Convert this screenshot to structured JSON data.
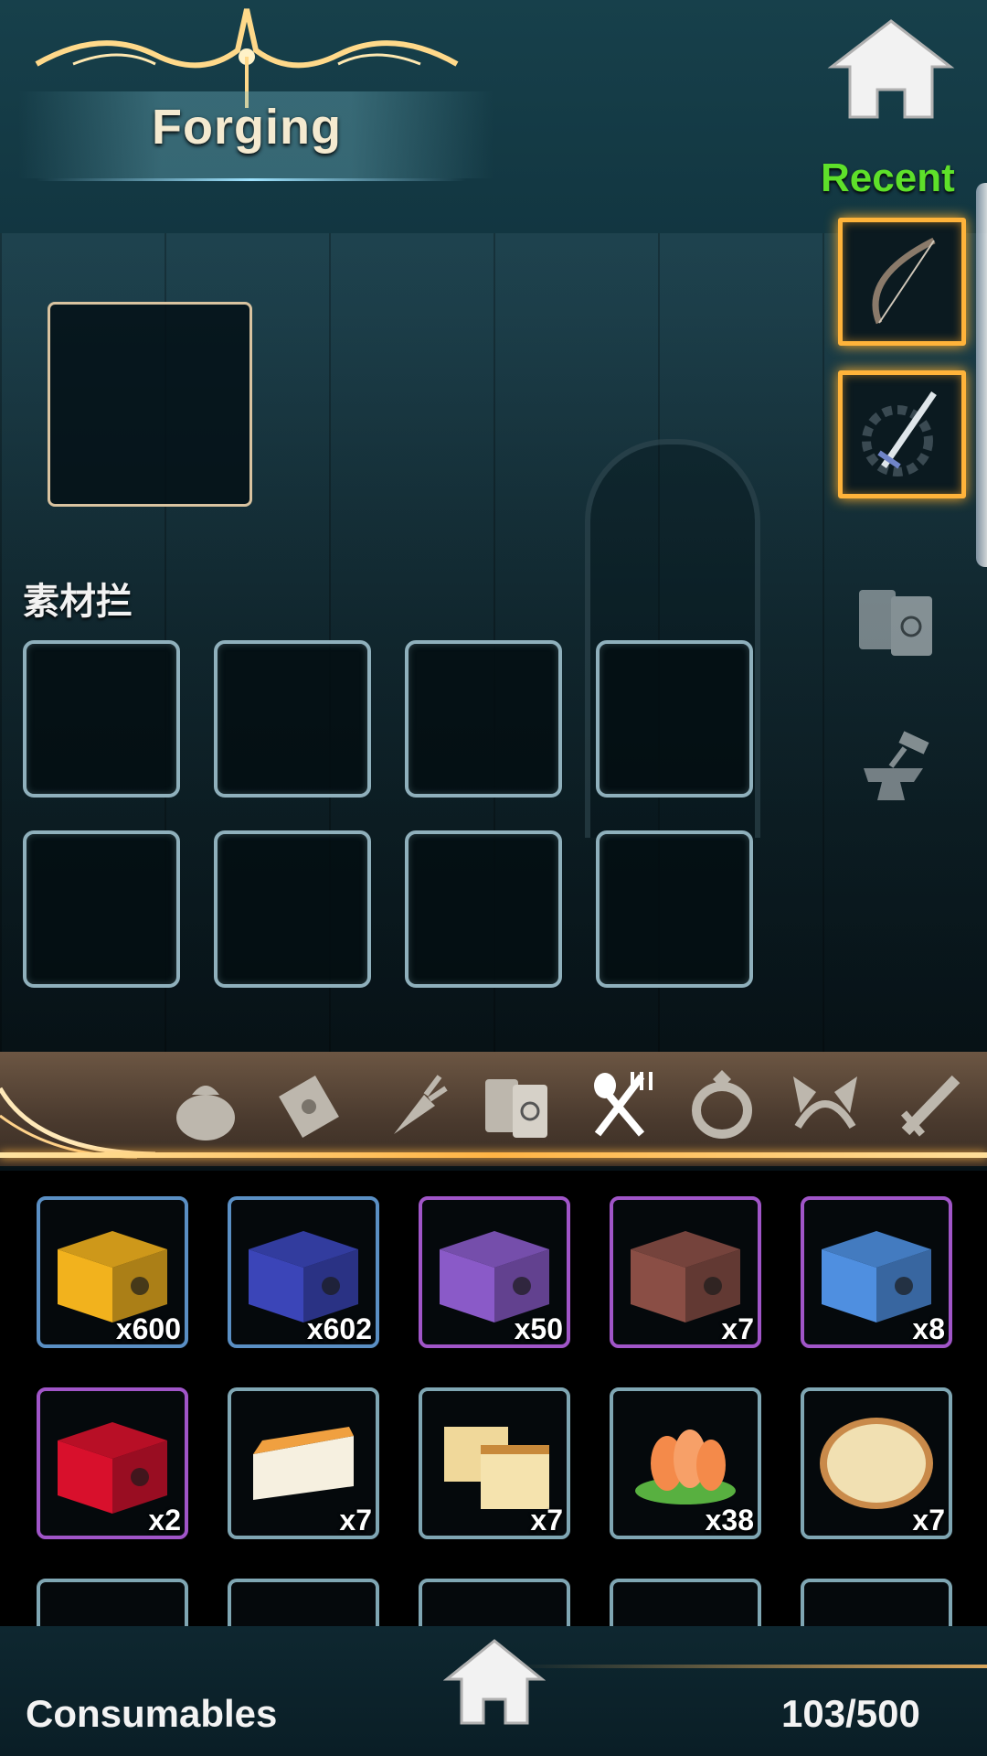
{
  "header": {
    "title": "Forging",
    "recent_label": "Recent",
    "recent_items": [
      {
        "icon": "bow-icon"
      },
      {
        "icon": "sword-icon"
      }
    ],
    "side_icons": [
      "book-icon",
      "anvil-icon"
    ]
  },
  "materials": {
    "label": "素材拦",
    "slot_count": 8
  },
  "tabs": [
    {
      "icon": "bag-icon",
      "active": false
    },
    {
      "icon": "scroll-icon",
      "active": false
    },
    {
      "icon": "carrot-icon",
      "active": false
    },
    {
      "icon": "book-icon",
      "active": false
    },
    {
      "icon": "utensils-icon",
      "active": true
    },
    {
      "icon": "ring-icon",
      "active": false
    },
    {
      "icon": "cat-ears-icon",
      "active": false
    },
    {
      "icon": "sword-icon",
      "active": false
    }
  ],
  "inventory": {
    "items": [
      {
        "name": "gold-box",
        "qty": "x600",
        "rarity_color": "#5a8fc4",
        "fill": "#f2b21d"
      },
      {
        "name": "blue-box",
        "qty": "x602",
        "rarity_color": "#5a8fc4",
        "fill": "#3b45b8"
      },
      {
        "name": "purple-box",
        "qty": "x50",
        "rarity_color": "#a055c8",
        "fill": "#8a5ac8"
      },
      {
        "name": "brown-box",
        "qty": "x7",
        "rarity_color": "#a055c8",
        "fill": "#8a4e45"
      },
      {
        "name": "sky-box",
        "qty": "x8",
        "rarity_color": "#a055c8",
        "fill": "#4f8fe0"
      },
      {
        "name": "red-box",
        "qty": "x2",
        "rarity_color": "#a055c8",
        "fill": "#d8102c"
      },
      {
        "name": "cheesecake",
        "qty": "x7",
        "rarity_color": "#7fa6b3",
        "fill": "#f0a040"
      },
      {
        "name": "castella",
        "qty": "x7",
        "rarity_color": "#7fa6b3",
        "fill": "#f0d89a"
      },
      {
        "name": "salmon-sashimi",
        "qty": "x38",
        "rarity_color": "#7fa6b3",
        "fill": "#f48a4a"
      },
      {
        "name": "pizza",
        "qty": "x7",
        "rarity_color": "#7fa6b3",
        "fill": "#f1e0b2"
      },
      {
        "name": "partial-1",
        "qty": "",
        "rarity_color": "#7fa6b3",
        "fill": "#000000"
      },
      {
        "name": "partial-2",
        "qty": "",
        "rarity_color": "#7fa6b3",
        "fill": "#000000"
      },
      {
        "name": "partial-3",
        "qty": "",
        "rarity_color": "#7fa6b3",
        "fill": "#000000"
      },
      {
        "name": "partial-4",
        "qty": "",
        "rarity_color": "#7fa6b3",
        "fill": "#000000"
      },
      {
        "name": "partial-5",
        "qty": "",
        "rarity_color": "#7fa6b3",
        "fill": "#000000"
      }
    ]
  },
  "footer": {
    "category": "Consumables",
    "count": "103/500"
  }
}
